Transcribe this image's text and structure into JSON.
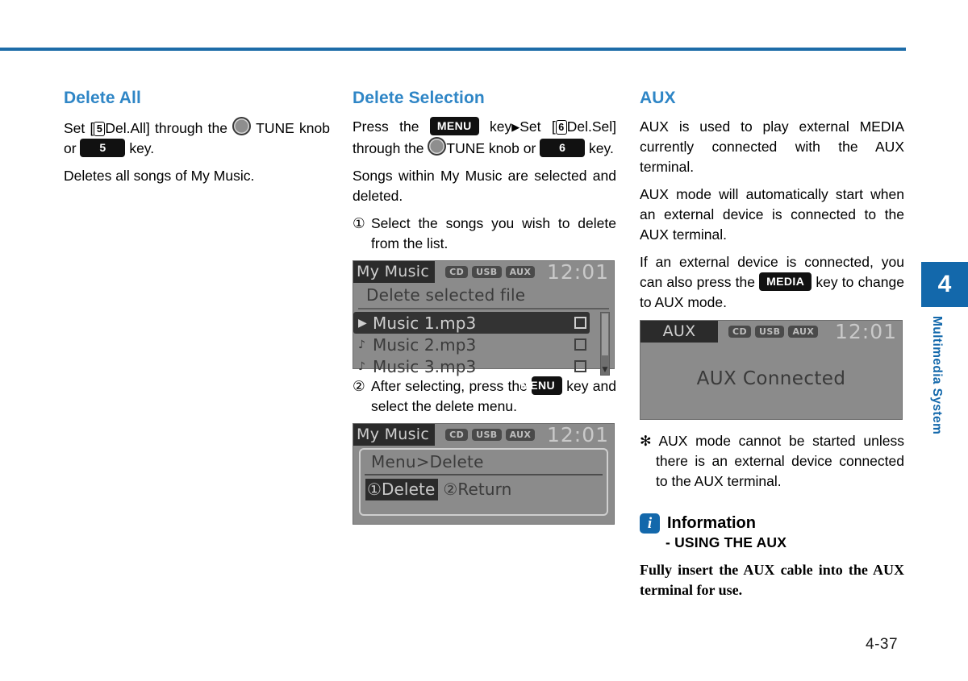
{
  "page": {
    "number": "4-37",
    "chapter_number": "4",
    "chapter_label": "Multimedia System"
  },
  "column_left": {
    "title": "Delete All",
    "para1_a": "Set [",
    "para1_boxnum": "5",
    "para1_b": "Del.All] through the",
    "para1_tune": "TUNE",
    "para1_c": "knob or",
    "para1_key": "5",
    "para1_d": "key.",
    "para2": "Deletes all songs of My Music."
  },
  "column_middle": {
    "title": "Delete Selection",
    "para1_a": "Press the",
    "para1_menu_key": "MENU",
    "para1_b": "key",
    "para1_arrow": "▶",
    "para1_c": "Set [",
    "para1_boxnum": "6",
    "para1_d": "Del.Sel] through the",
    "para1_tune": "TUNE knob or",
    "para1_key": "6",
    "para1_e": "key.",
    "para2": "Songs within My Music are selected and deleted.",
    "step1_marker": "①",
    "step1_text": "Select the songs you wish to delete from the list.",
    "step2_marker": "②",
    "step2_text_a": "After selecting, press the",
    "step2_key": "MENU",
    "step2_text_b": "key and select the delete menu.",
    "screen_list": {
      "title": "My Music",
      "badges": [
        "CD",
        "USB",
        "AUX"
      ],
      "clock": "12:01",
      "subtitle": "Delete selected file",
      "items": [
        {
          "icon": "▶",
          "label": "Music 1.mp3",
          "checked": false,
          "selected": true
        },
        {
          "icon": "♪",
          "label": "Music 2.mp3",
          "checked": false,
          "selected": false
        },
        {
          "icon": "♪",
          "label": "Music 3.mp3",
          "checked": false,
          "selected": false
        }
      ]
    },
    "screen_menu": {
      "title": "My Music",
      "badges": [
        "CD",
        "USB",
        "AUX"
      ],
      "clock": "12:01",
      "heading": "Menu>Delete",
      "option1": "①Delete",
      "option2": "②Return"
    }
  },
  "column_right": {
    "title": "AUX",
    "para1": "AUX is used to play external MEDIA currently connected with the AUX terminal.",
    "para2": "AUX mode will automatically start when an external device is connected to the AUX terminal.",
    "para3_a": "If an external device is connected, you can also press the",
    "para3_key": "MEDIA",
    "para3_b": "key to change to AUX mode.",
    "screen_aux": {
      "title": "AUX",
      "badges": [
        "CD",
        "USB",
        "AUX"
      ],
      "clock": "12:01",
      "message": "AUX Connected"
    },
    "note_marker": "✻",
    "note_text": "AUX mode cannot be started unless there is an external device connected to the AUX terminal.",
    "info_icon_letter": "i",
    "info_title": "Information",
    "info_subtitle": "- USING THE AUX",
    "info_body": "Fully insert the AUX cable into the AUX terminal for use."
  },
  "colors": {
    "heading_blue": "#2f86c6",
    "rule_blue": "#1d6ca8",
    "tab_blue": "#1368ab"
  }
}
